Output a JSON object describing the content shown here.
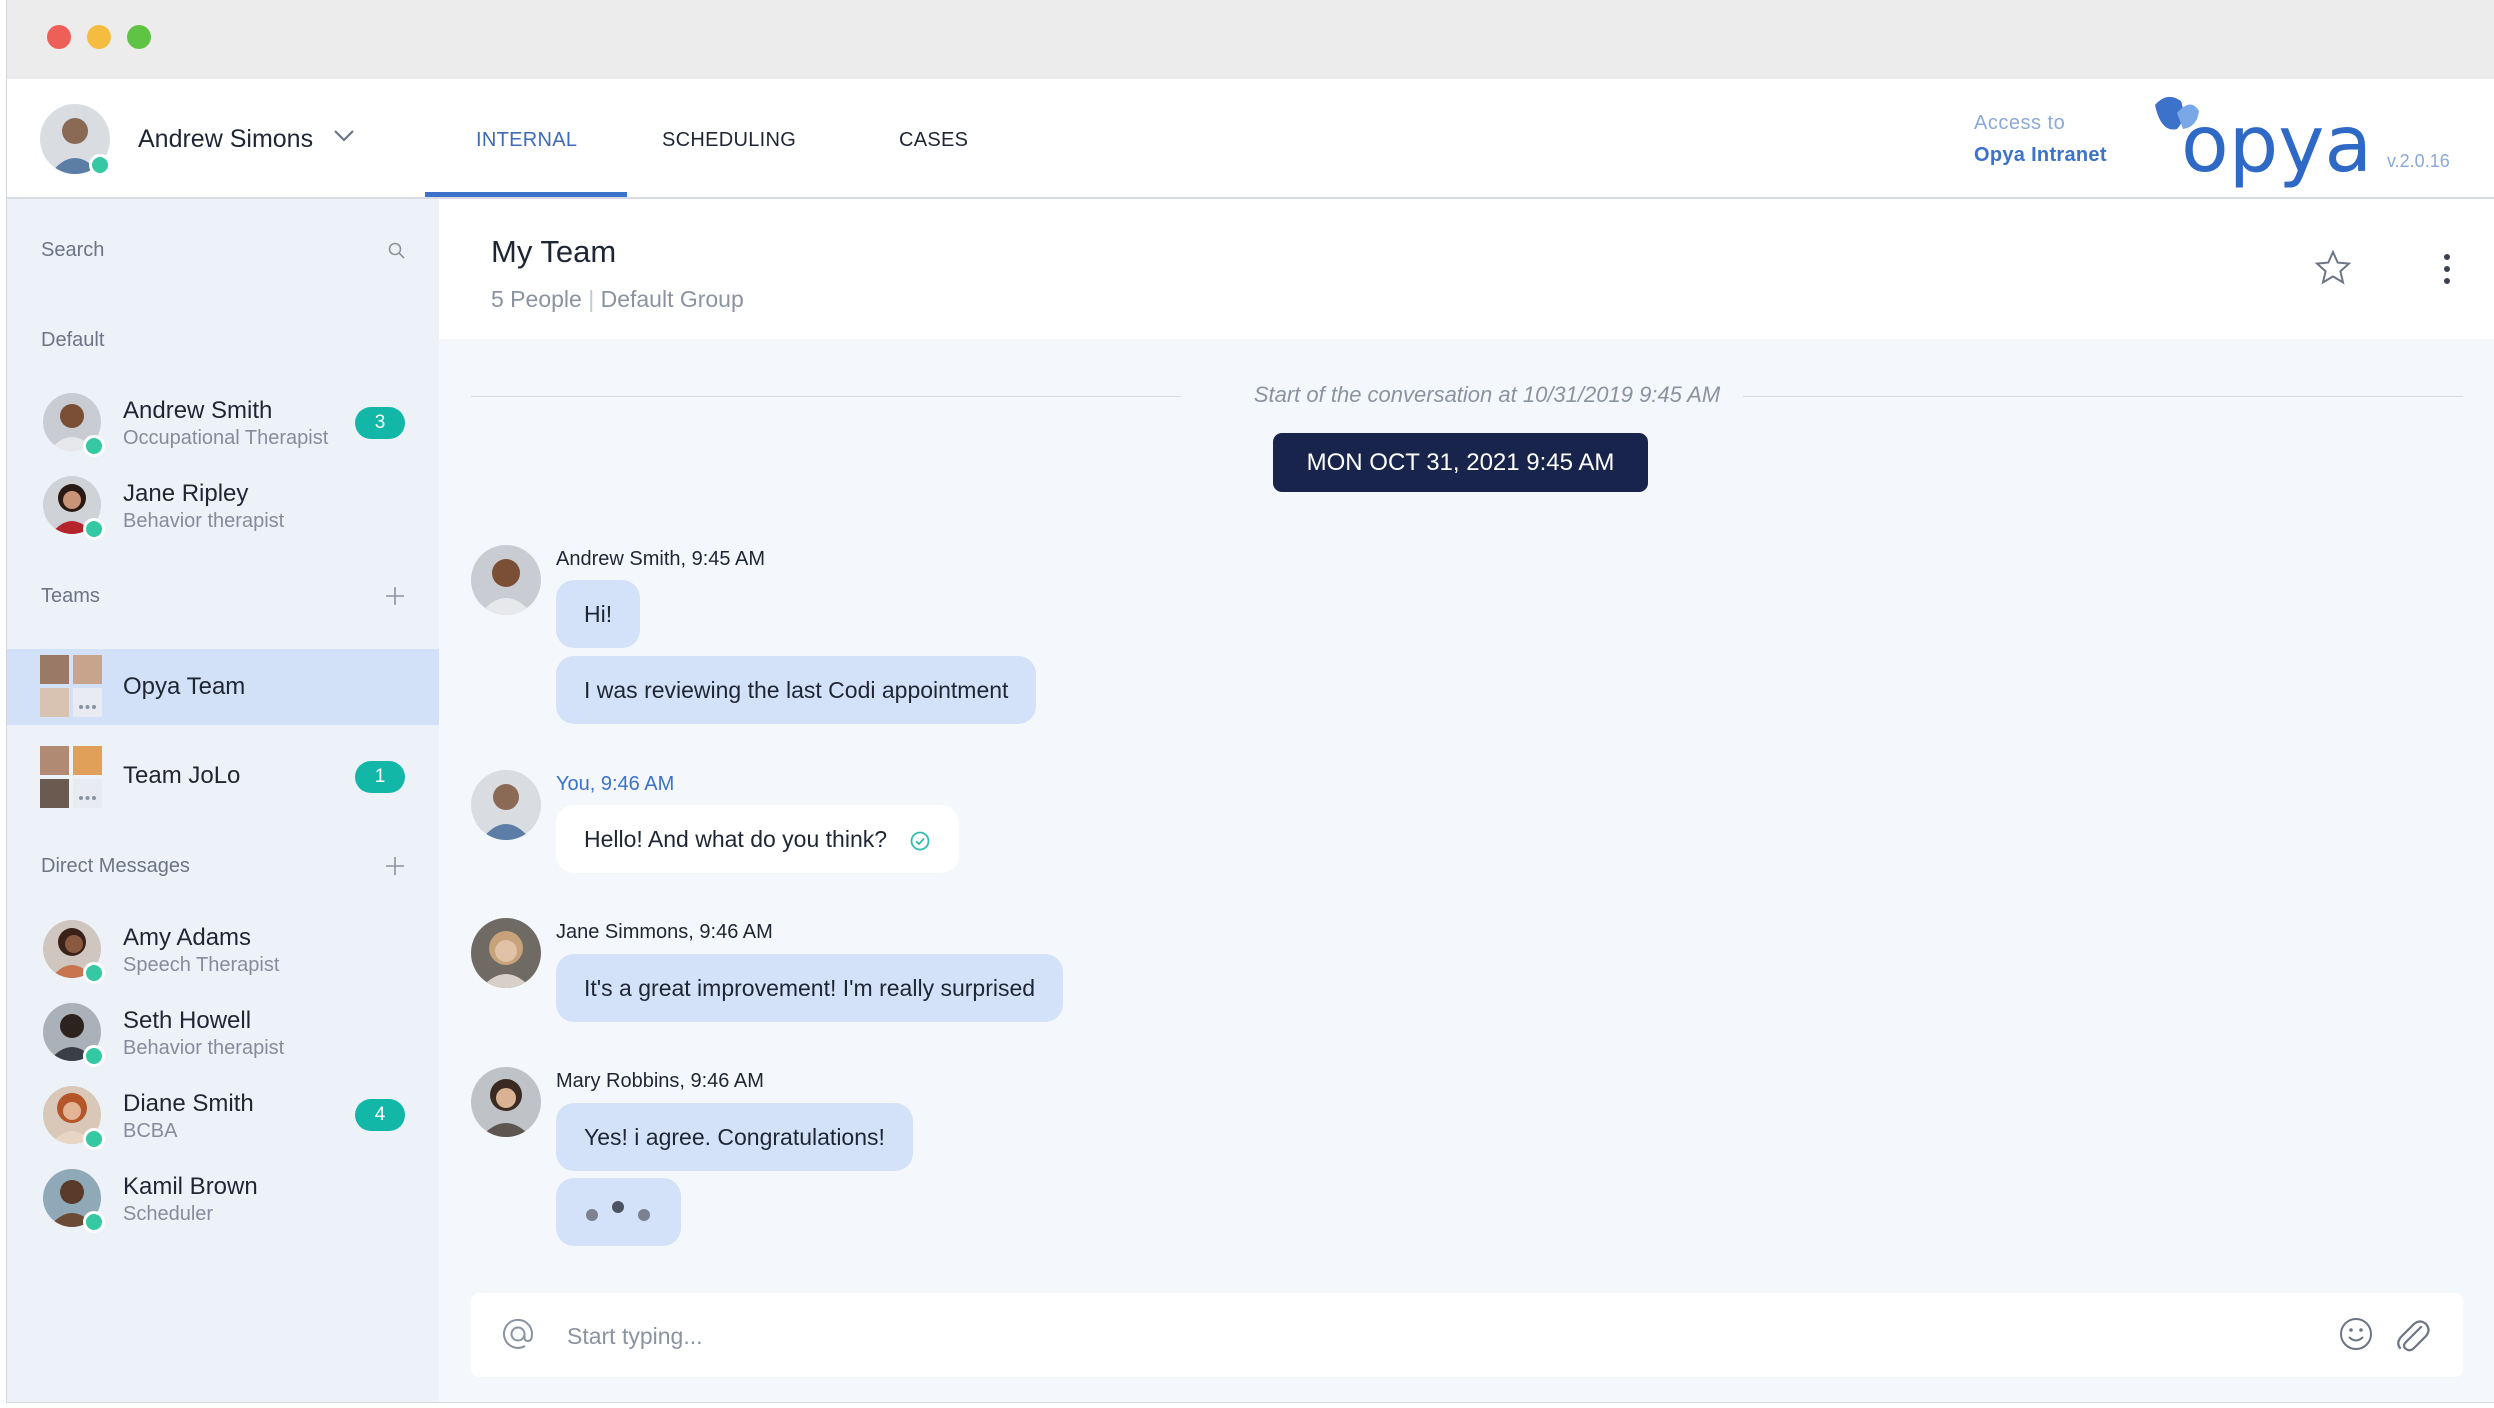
{
  "user": {
    "name": "Andrew Simons"
  },
  "tabs": [
    {
      "label": "INTERNAL",
      "active": true
    },
    {
      "label": "SCHEDULING",
      "active": false
    },
    {
      "label": "CASES",
      "active": false
    }
  ],
  "brand": {
    "access_line1": "Access to",
    "access_line2": "Opya Intranet",
    "logo_text": "opya",
    "version": "v.2.0.16",
    "accent_color": "#3c72c9"
  },
  "sidebar": {
    "search_placeholder": "Search",
    "default_label": "Default",
    "default_contacts": [
      {
        "name": "Andrew Smith",
        "role": "Occupational Therapist",
        "badge": "3"
      },
      {
        "name": "Jane Ripley",
        "role": "Behavior therapist",
        "badge": ""
      }
    ],
    "teams_label": "Teams",
    "teams": [
      {
        "name": "Opya Team",
        "badge": "",
        "active": true
      },
      {
        "name": "Team JoLo",
        "badge": "1",
        "active": false
      }
    ],
    "dm_label": "Direct Messages",
    "direct_messages": [
      {
        "name": "Amy Adams",
        "role": "Speech Therapist",
        "badge": ""
      },
      {
        "name": "Seth Howell",
        "role": "Behavior therapist",
        "badge": ""
      },
      {
        "name": "Diane Smith",
        "role": "BCBA",
        "badge": "4"
      },
      {
        "name": "Kamil Brown",
        "role": "Scheduler",
        "badge": ""
      }
    ]
  },
  "conversation": {
    "title": "My Team",
    "people": "5 People",
    "group": "Default Group",
    "start_text": "Start of the conversation at 10/31/2019 9:45 AM",
    "date_pill": "MON OCT 31, 2021 9:45 AM",
    "messages": [
      {
        "sender": "Andrew Smith, 9:45 AM",
        "bubbles": [
          "Hi!",
          "I was reviewing the last Codi appointment"
        ]
      },
      {
        "sender": "You, 9:46 AM",
        "bubbles": [
          "Hello! And what do you think?"
        ]
      },
      {
        "sender": "Jane Simmons, 9:46 AM",
        "bubbles": [
          "It's a great improvement!  I'm really surprised"
        ]
      },
      {
        "sender": "Mary Robbins, 9:46 AM",
        "bubbles": [
          "Yes! i agree. Congratulations!"
        ]
      }
    ]
  },
  "composer": {
    "placeholder": "Start typing..."
  },
  "icons": [
    "search-icon",
    "plus-icon",
    "star-icon",
    "kebab-icon",
    "at-icon",
    "smile-icon",
    "paperclip-icon",
    "check-circle-icon",
    "chevron-down-icon"
  ]
}
